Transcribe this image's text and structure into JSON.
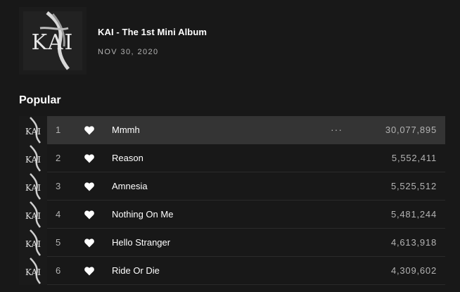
{
  "album": {
    "title": "KAI - The 1st Mini Album",
    "release_date": "NOV 30, 2020",
    "cover_art": "KAI album cover art"
  },
  "section": {
    "title": "Popular"
  },
  "tracks": [
    {
      "number": "1",
      "name": "Mmmh",
      "plays": "30,077,895",
      "liked": true,
      "hovered": true,
      "more_label": "···"
    },
    {
      "number": "2",
      "name": "Reason",
      "plays": "5,552,411",
      "liked": true,
      "hovered": false
    },
    {
      "number": "3",
      "name": "Amnesia",
      "plays": "5,525,512",
      "liked": true,
      "hovered": false
    },
    {
      "number": "4",
      "name": "Nothing On Me",
      "plays": "5,481,244",
      "liked": true,
      "hovered": false
    },
    {
      "number": "5",
      "name": "Hello Stranger",
      "plays": "4,613,918",
      "liked": true,
      "hovered": false
    },
    {
      "number": "6",
      "name": "Ride Or Die",
      "plays": "4,309,602",
      "liked": true,
      "hovered": false
    }
  ],
  "colors": {
    "background": "#181818",
    "row_hover": "#343434",
    "text_primary": "#ffffff",
    "text_secondary": "#b3b3b3"
  },
  "icons": {
    "like": "heart-icon",
    "more": "more-options-icon"
  }
}
